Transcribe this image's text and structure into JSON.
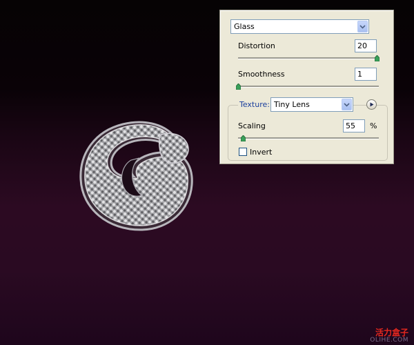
{
  "filter_select": {
    "value": "Glass"
  },
  "distortion": {
    "label": "Distortion",
    "value": "20",
    "level": 1.0
  },
  "smoothness": {
    "label": "Smoothness",
    "value": "1",
    "level": 0.0
  },
  "texture": {
    "label": "Texture:",
    "value": "Tiny Lens"
  },
  "scaling": {
    "label": "Scaling",
    "value": "55",
    "unit": "%",
    "level": 0.02
  },
  "invert": {
    "label": "Invert",
    "checked": false
  },
  "watermark": {
    "cn": "活力盒子",
    "en": "OLIHE.COM"
  },
  "colors": {
    "panel_bg": "#ece9d8",
    "letter_highlight": "#c9c9cc",
    "bg_top": "#060304",
    "bg_bottom": "#2c0a22",
    "watermark_red": "#e8281f"
  },
  "icons": {
    "dropdown": "chevron-down-icon",
    "texture_menu": "play-arrow-icon",
    "slider": "triangle-slider-thumb-icon"
  }
}
